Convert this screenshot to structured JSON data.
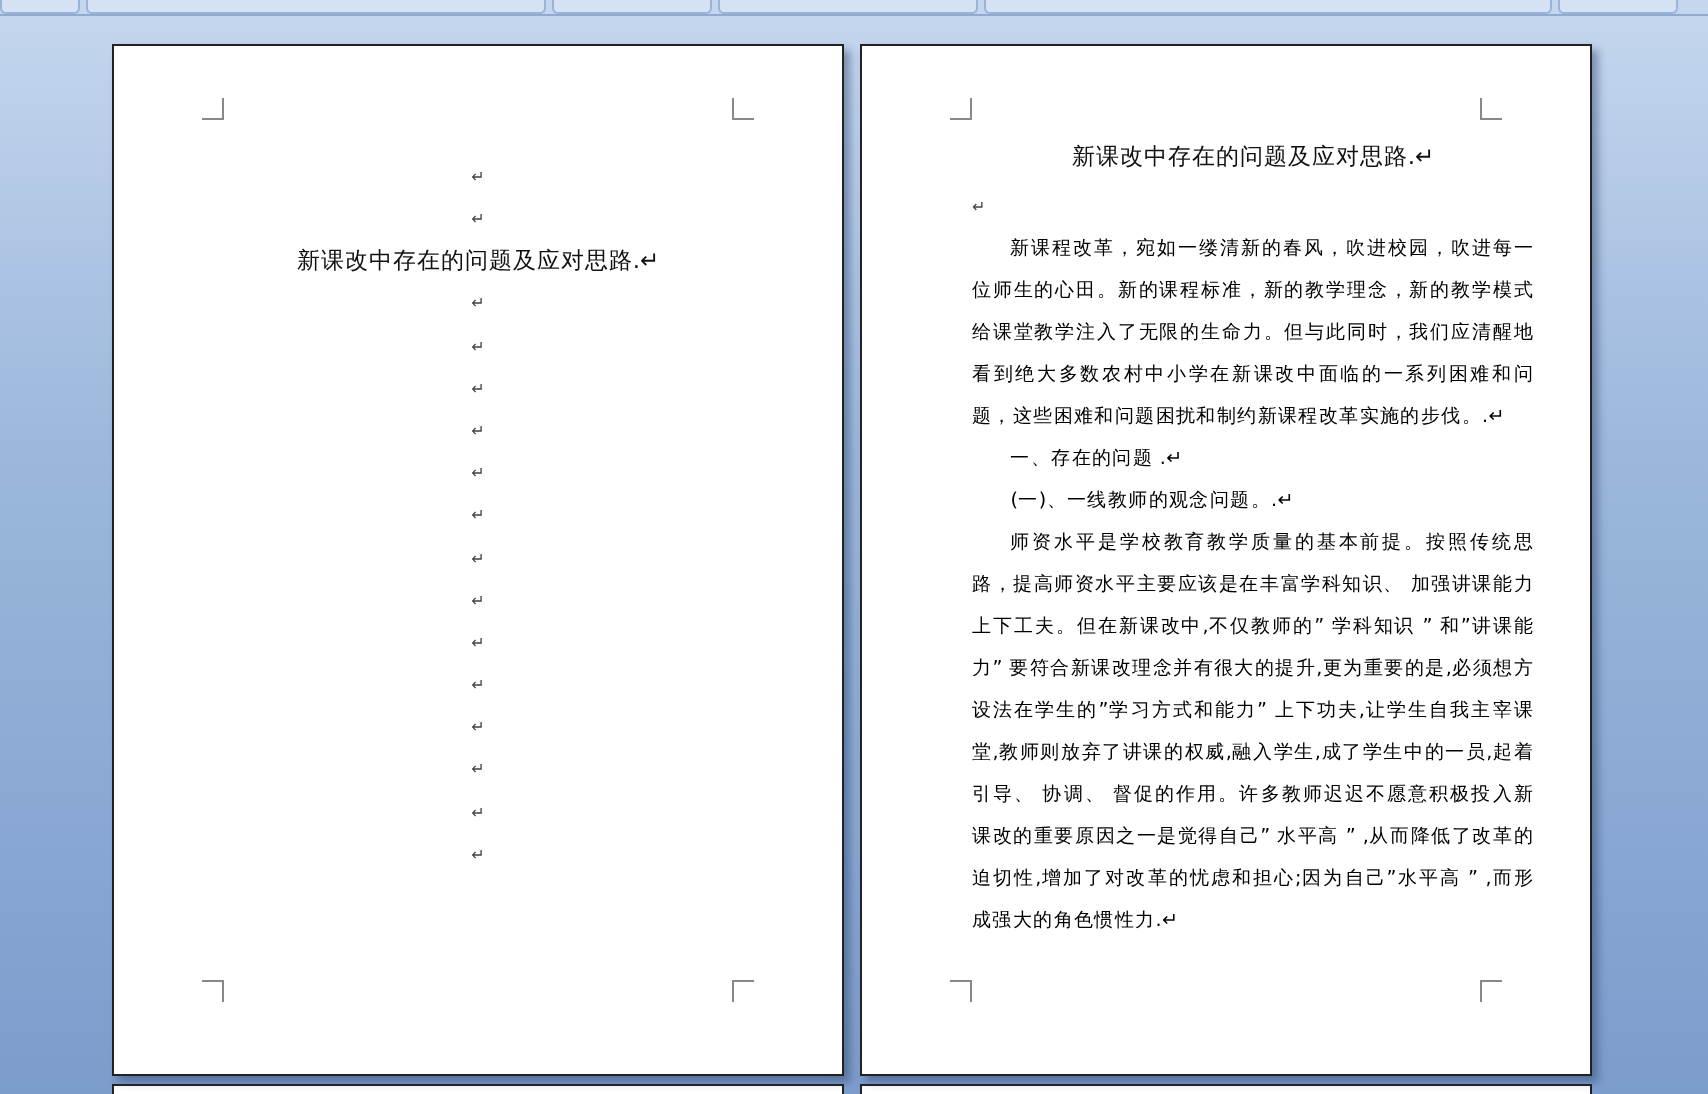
{
  "pages": [
    {
      "kind": "blank",
      "paragraphs": [
        {
          "kind": "empty",
          "text": "↵"
        },
        {
          "kind": "empty",
          "text": "↵"
        },
        {
          "kind": "title",
          "text": "新课改中存在的问题及应对思路.↵"
        },
        {
          "kind": "empty",
          "text": "↵"
        },
        {
          "kind": "empty",
          "text": "↵"
        },
        {
          "kind": "empty",
          "text": "↵"
        },
        {
          "kind": "empty",
          "text": "↵"
        },
        {
          "kind": "empty",
          "text": "↵"
        },
        {
          "kind": "empty",
          "text": "↵"
        },
        {
          "kind": "empty",
          "text": "↵"
        },
        {
          "kind": "empty",
          "text": "↵"
        },
        {
          "kind": "empty",
          "text": "↵"
        },
        {
          "kind": "empty",
          "text": "↵"
        },
        {
          "kind": "empty",
          "text": "↵"
        },
        {
          "kind": "empty",
          "text": "↵"
        },
        {
          "kind": "empty",
          "text": "↵"
        },
        {
          "kind": "empty",
          "text": "↵"
        }
      ]
    },
    {
      "kind": "text",
      "paragraphs": [
        {
          "kind": "title",
          "text": "新课改中存在的问题及应对思路.↵"
        },
        {
          "kind": "mark",
          "text": "↵"
        },
        {
          "kind": "body",
          "text": "新课程改革，宛如一缕清新的春风，吹进校园，吹进每一位师生的心田。新的课程标准，新的教学理念，新的教学模式给课堂教学注入了无限的生命力。但与此同时，我们应清醒地看到绝大多数农村中小学在新课改中面临的一系列困难和问题，这些困难和问题困扰和制约新课程改革实施的步伐。.↵"
        },
        {
          "kind": "body",
          "text": "一、存在的问题 .↵"
        },
        {
          "kind": "body",
          "text": "(一)、一线教师的观念问题。.↵"
        },
        {
          "kind": "body",
          "text": "师资水平是学校教育教学质量的基本前提。按照传统思路，提高师资水平主要应该是在丰富学科知识、 加强讲课能力上下工夫。但在新课改中,不仅教师的” 学科知识 ” 和”讲课能力” 要符合新课改理念并有很大的提升,更为重要的是,必须想方设法在学生的”学习方式和能力” 上下功夫,让学生自我主宰课堂,教师则放弃了讲课的权威,融入学生,成了学生中的一员,起着引导、 协调、 督促的作用。许多教师迟迟不愿意积极投入新课改的重要原因之一是觉得自己” 水平高 ” ,从而降低了改革的迫切性,增加了对改革的忧虑和担心;因为自己”水平高 ” ,而形成强大的角色惯性力.↵"
        }
      ]
    }
  ]
}
